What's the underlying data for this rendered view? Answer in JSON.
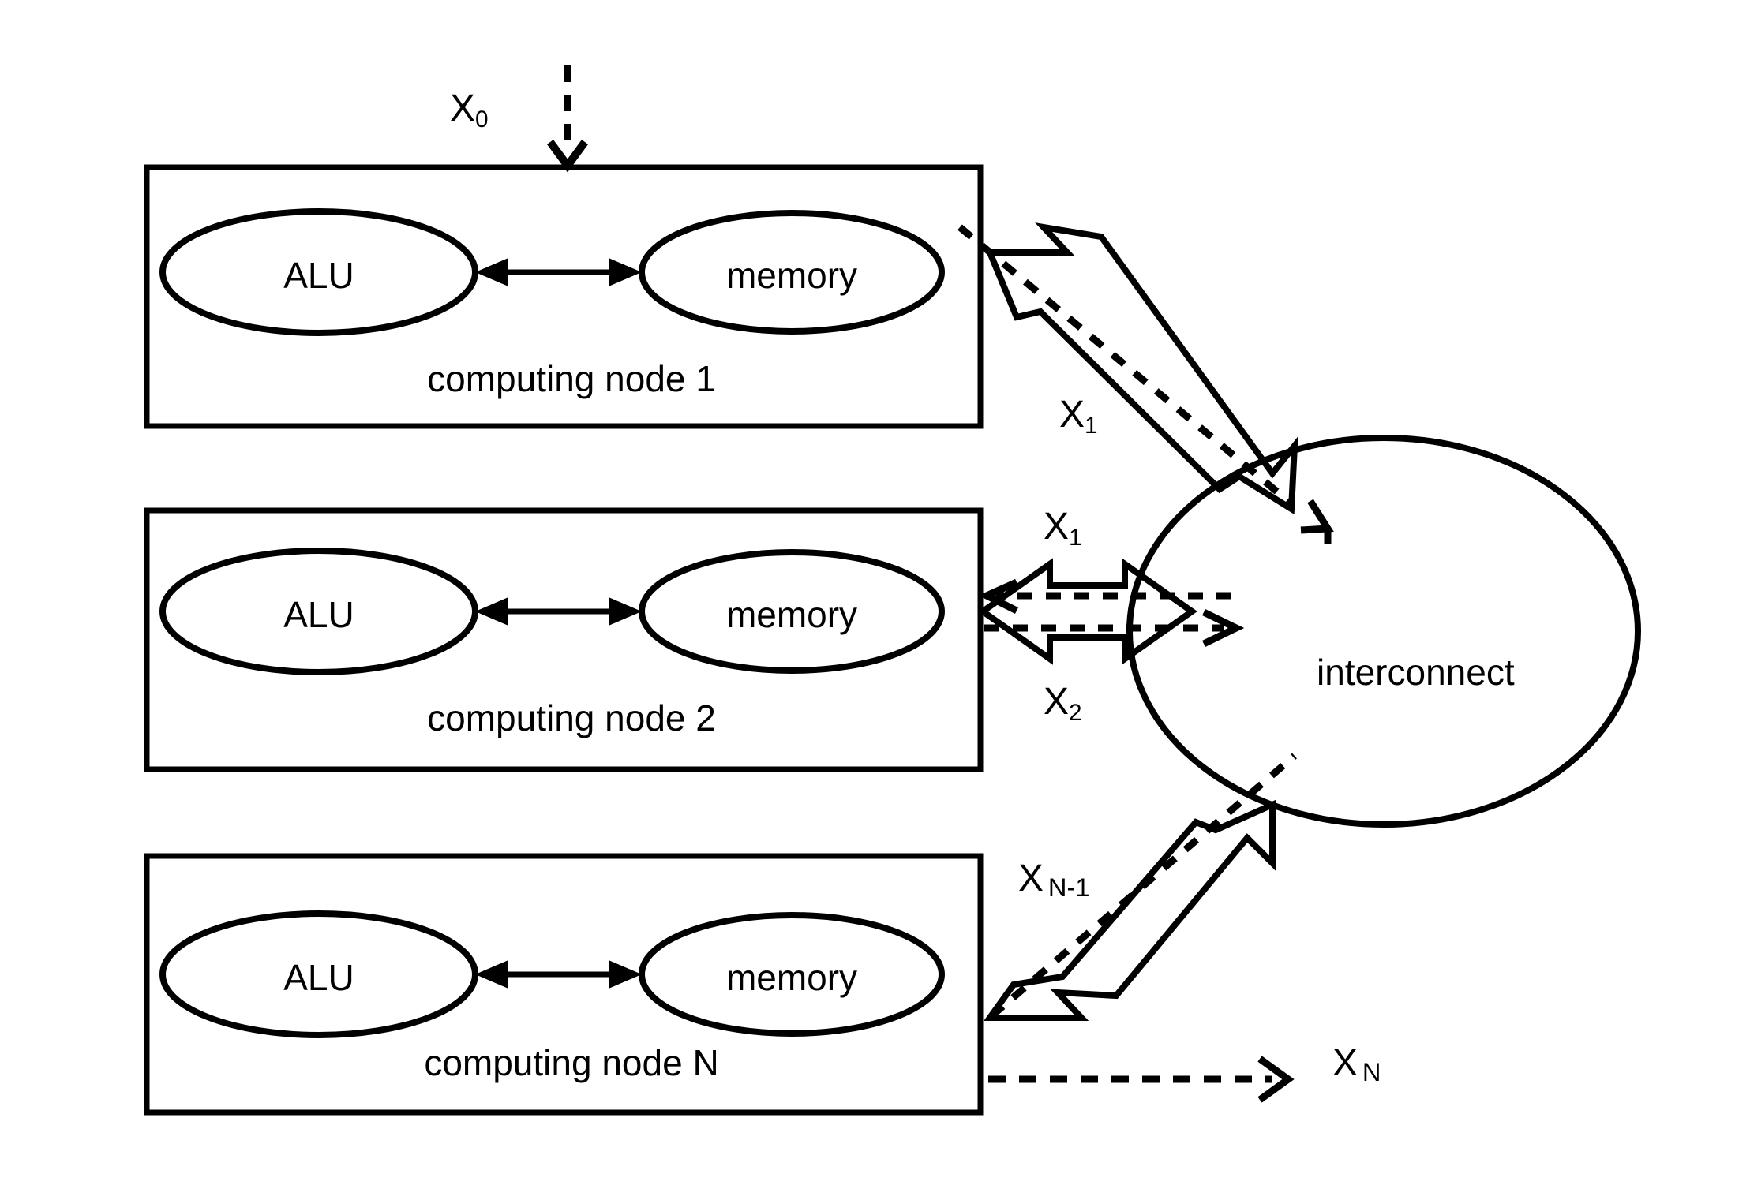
{
  "figure": {
    "type": "block-diagram",
    "title": "",
    "background_color": "#ffffff",
    "stroke_color": "#000000"
  },
  "nodes": [
    {
      "id": "node1",
      "box_label": "computing node 1",
      "units": [
        {
          "name": "alu",
          "label": "ALU"
        },
        {
          "name": "memory",
          "label": "memory"
        }
      ],
      "internal_link": "bidirectional"
    },
    {
      "id": "node2",
      "box_label": "computing node 2",
      "units": [
        {
          "name": "alu",
          "label": "ALU"
        },
        {
          "name": "memory",
          "label": "memory"
        }
      ],
      "internal_link": "bidirectional"
    },
    {
      "id": "nodeN",
      "box_label": "computing node N",
      "units": [
        {
          "name": "alu",
          "label": "ALU"
        },
        {
          "name": "memory",
          "label": "memory"
        }
      ],
      "internal_link": "bidirectional"
    }
  ],
  "interconnect": {
    "label": "interconnect",
    "shape": "ellipse"
  },
  "signals": [
    {
      "id": "x0",
      "base": "X",
      "subscript": "0",
      "description": "dashed input arrow entering computing node 1 from above"
    },
    {
      "id": "x1_top",
      "base": "X",
      "subscript": "1",
      "description": "thick bidirectional arrow between computing node 1 and interconnect"
    },
    {
      "id": "x1_mid",
      "base": "X",
      "subscript": "1",
      "description": "thick bidirectional arrow between computing node 2 and interconnect (upper label)"
    },
    {
      "id": "x2_mid",
      "base": "X",
      "subscript": "2",
      "description": "thick bidirectional arrow between computing node 2 and interconnect (lower label)"
    },
    {
      "id": "xn_minus_1",
      "base": "X",
      "subscript": "N-1",
      "description": "thick bidirectional arrow between computing node N and interconnect"
    },
    {
      "id": "xn",
      "base": "X",
      "subscript": "N",
      "description": "dashed output arrow leaving computing node N to the right"
    }
  ]
}
